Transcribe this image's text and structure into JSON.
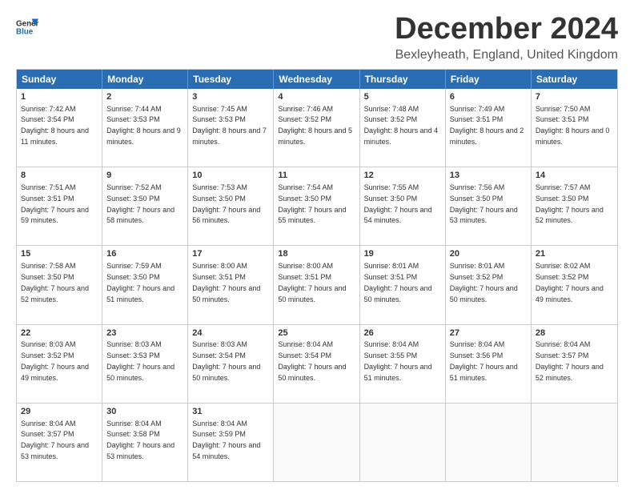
{
  "header": {
    "logo_line1": "General",
    "logo_line2": "Blue",
    "month_title": "December 2024",
    "location": "Bexleyheath, England, United Kingdom"
  },
  "days_of_week": [
    "Sunday",
    "Monday",
    "Tuesday",
    "Wednesday",
    "Thursday",
    "Friday",
    "Saturday"
  ],
  "weeks": [
    [
      {
        "day": "1",
        "sunrise": "7:42 AM",
        "sunset": "3:54 PM",
        "daylight": "8 hours and 11 minutes."
      },
      {
        "day": "2",
        "sunrise": "7:44 AM",
        "sunset": "3:53 PM",
        "daylight": "8 hours and 9 minutes."
      },
      {
        "day": "3",
        "sunrise": "7:45 AM",
        "sunset": "3:53 PM",
        "daylight": "8 hours and 7 minutes."
      },
      {
        "day": "4",
        "sunrise": "7:46 AM",
        "sunset": "3:52 PM",
        "daylight": "8 hours and 5 minutes."
      },
      {
        "day": "5",
        "sunrise": "7:48 AM",
        "sunset": "3:52 PM",
        "daylight": "8 hours and 4 minutes."
      },
      {
        "day": "6",
        "sunrise": "7:49 AM",
        "sunset": "3:51 PM",
        "daylight": "8 hours and 2 minutes."
      },
      {
        "day": "7",
        "sunrise": "7:50 AM",
        "sunset": "3:51 PM",
        "daylight": "8 hours and 0 minutes."
      }
    ],
    [
      {
        "day": "8",
        "sunrise": "7:51 AM",
        "sunset": "3:51 PM",
        "daylight": "7 hours and 59 minutes."
      },
      {
        "day": "9",
        "sunrise": "7:52 AM",
        "sunset": "3:50 PM",
        "daylight": "7 hours and 58 minutes."
      },
      {
        "day": "10",
        "sunrise": "7:53 AM",
        "sunset": "3:50 PM",
        "daylight": "7 hours and 56 minutes."
      },
      {
        "day": "11",
        "sunrise": "7:54 AM",
        "sunset": "3:50 PM",
        "daylight": "7 hours and 55 minutes."
      },
      {
        "day": "12",
        "sunrise": "7:55 AM",
        "sunset": "3:50 PM",
        "daylight": "7 hours and 54 minutes."
      },
      {
        "day": "13",
        "sunrise": "7:56 AM",
        "sunset": "3:50 PM",
        "daylight": "7 hours and 53 minutes."
      },
      {
        "day": "14",
        "sunrise": "7:57 AM",
        "sunset": "3:50 PM",
        "daylight": "7 hours and 52 minutes."
      }
    ],
    [
      {
        "day": "15",
        "sunrise": "7:58 AM",
        "sunset": "3:50 PM",
        "daylight": "7 hours and 52 minutes."
      },
      {
        "day": "16",
        "sunrise": "7:59 AM",
        "sunset": "3:50 PM",
        "daylight": "7 hours and 51 minutes."
      },
      {
        "day": "17",
        "sunrise": "8:00 AM",
        "sunset": "3:51 PM",
        "daylight": "7 hours and 50 minutes."
      },
      {
        "day": "18",
        "sunrise": "8:00 AM",
        "sunset": "3:51 PM",
        "daylight": "7 hours and 50 minutes."
      },
      {
        "day": "19",
        "sunrise": "8:01 AM",
        "sunset": "3:51 PM",
        "daylight": "7 hours and 50 minutes."
      },
      {
        "day": "20",
        "sunrise": "8:01 AM",
        "sunset": "3:52 PM",
        "daylight": "7 hours and 50 minutes."
      },
      {
        "day": "21",
        "sunrise": "8:02 AM",
        "sunset": "3:52 PM",
        "daylight": "7 hours and 49 minutes."
      }
    ],
    [
      {
        "day": "22",
        "sunrise": "8:03 AM",
        "sunset": "3:52 PM",
        "daylight": "7 hours and 49 minutes."
      },
      {
        "day": "23",
        "sunrise": "8:03 AM",
        "sunset": "3:53 PM",
        "daylight": "7 hours and 50 minutes."
      },
      {
        "day": "24",
        "sunrise": "8:03 AM",
        "sunset": "3:54 PM",
        "daylight": "7 hours and 50 minutes."
      },
      {
        "day": "25",
        "sunrise": "8:04 AM",
        "sunset": "3:54 PM",
        "daylight": "7 hours and 50 minutes."
      },
      {
        "day": "26",
        "sunrise": "8:04 AM",
        "sunset": "3:55 PM",
        "daylight": "7 hours and 51 minutes."
      },
      {
        "day": "27",
        "sunrise": "8:04 AM",
        "sunset": "3:56 PM",
        "daylight": "7 hours and 51 minutes."
      },
      {
        "day": "28",
        "sunrise": "8:04 AM",
        "sunset": "3:57 PM",
        "daylight": "7 hours and 52 minutes."
      }
    ],
    [
      {
        "day": "29",
        "sunrise": "8:04 AM",
        "sunset": "3:57 PM",
        "daylight": "7 hours and 53 minutes."
      },
      {
        "day": "30",
        "sunrise": "8:04 AM",
        "sunset": "3:58 PM",
        "daylight": "7 hours and 53 minutes."
      },
      {
        "day": "31",
        "sunrise": "8:04 AM",
        "sunset": "3:59 PM",
        "daylight": "7 hours and 54 minutes."
      },
      {
        "day": "",
        "sunrise": "",
        "sunset": "",
        "daylight": ""
      },
      {
        "day": "",
        "sunrise": "",
        "sunset": "",
        "daylight": ""
      },
      {
        "day": "",
        "sunrise": "",
        "sunset": "",
        "daylight": ""
      },
      {
        "day": "",
        "sunrise": "",
        "sunset": "",
        "daylight": ""
      }
    ]
  ]
}
